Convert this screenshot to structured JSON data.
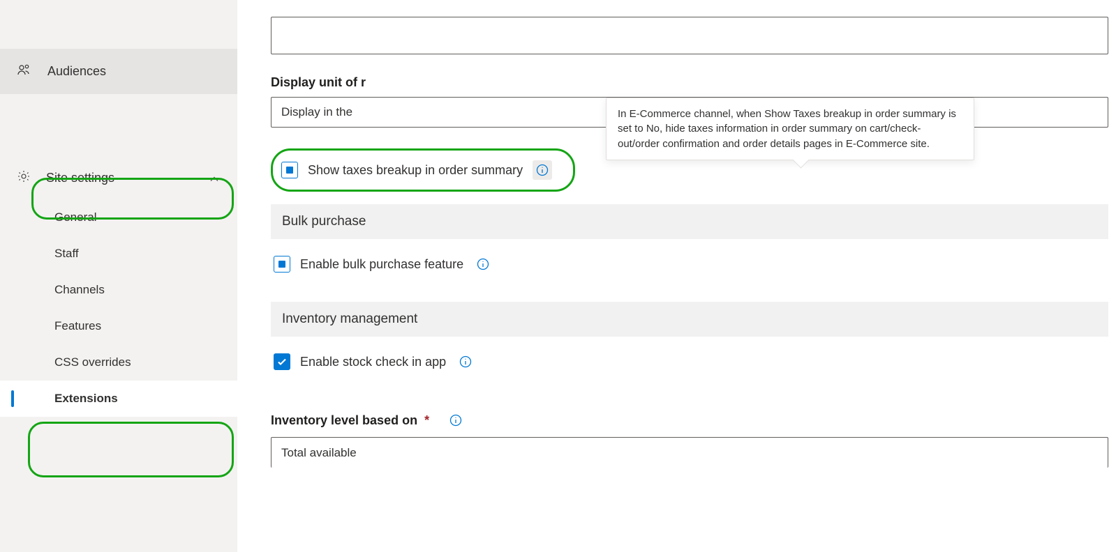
{
  "sidebar": {
    "audiences": "Audiences",
    "siteSettings": "Site settings",
    "items": [
      "General",
      "Staff",
      "Channels",
      "Features",
      "CSS overrides",
      "Extensions"
    ]
  },
  "main": {
    "displayUnitLabel": "Display unit of r",
    "displayUnitValue": "Display in the ",
    "tooltip": "In E-Commerce channel, when Show Taxes breakup in order summary is set to No, hide taxes information in order summary on cart/check-out/order confirmation and order details pages in E-Commerce site.",
    "showTaxesLabel": "Show taxes breakup in order summary",
    "bulkHeader": "Bulk purchase",
    "bulkLabel": "Enable bulk purchase feature",
    "inventoryHeader": "Inventory management",
    "stockLabel": "Enable stock check in app",
    "inventoryLevelLabel": "Inventory level based on",
    "inventoryLevelValue": "Total available"
  }
}
